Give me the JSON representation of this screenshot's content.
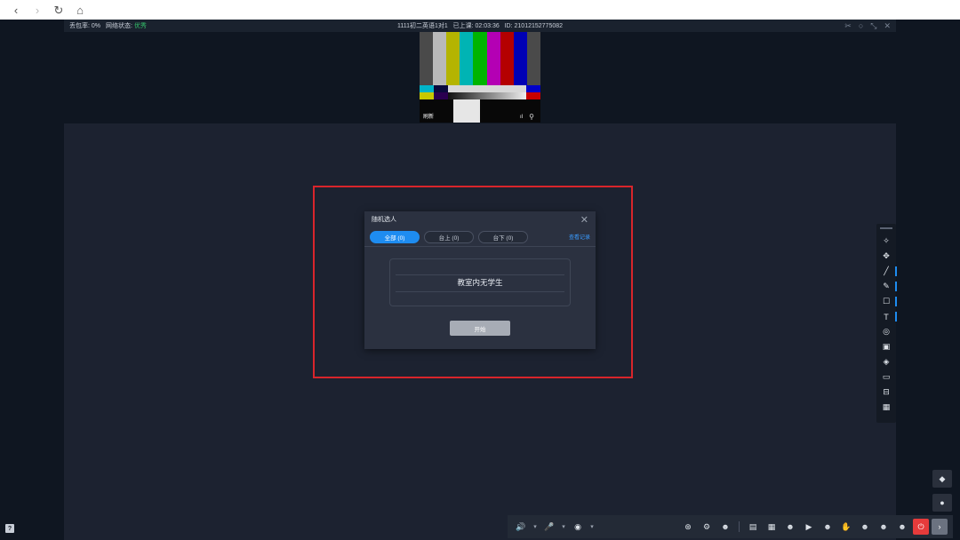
{
  "browser": {
    "back_icon": "‹",
    "forward_icon": "›",
    "refresh_icon": "↻",
    "home_icon": "⌂"
  },
  "status": {
    "loss_label": "丢包率:",
    "loss_value": "0%",
    "network_label": "网络状态:",
    "network_value": "优秀",
    "class_name": "1111初二英语1对1",
    "class_time_label": "已上课:",
    "class_time": "02:03:36",
    "id_label": "ID:",
    "id_value": "21012152775082",
    "icons": [
      "scissors-icon",
      "circle-icon",
      "shrink-icon",
      "close-icon"
    ]
  },
  "video": {
    "name": "刷新",
    "signal": "ıl",
    "mic": "🎙",
    "top_bars": [
      "#4a4a4a",
      "#b9b9b9",
      "#b4b400",
      "#00b4b4",
      "#00b400",
      "#b400b4",
      "#b40000",
      "#0000b4",
      "#4a4a4a"
    ],
    "colors": {
      "accent": "#1e8cf0",
      "highlight": "#d8252b"
    }
  },
  "dialog": {
    "title": "随机选人",
    "close": "✕",
    "tabs": [
      {
        "label": "全部 (0)",
        "active": true
      },
      {
        "label": "台上 (0)",
        "active": false
      },
      {
        "label": "台下 (0)",
        "active": false
      }
    ],
    "view_records": "查看记录",
    "empty_text": "教室内无学生",
    "start_label": "开始"
  },
  "toolbar": {
    "tools": [
      {
        "name": "laser-pointer-icon",
        "glyph": "✧"
      },
      {
        "name": "move-icon",
        "glyph": "✥"
      },
      {
        "name": "pen-icon",
        "glyph": "╱",
        "mark": true
      },
      {
        "name": "highlighter-icon",
        "glyph": "✎",
        "mark": true
      },
      {
        "name": "rectangle-icon",
        "glyph": "☐",
        "mark": true
      },
      {
        "name": "text-icon",
        "glyph": "T",
        "mark": true
      },
      {
        "name": "target-icon",
        "glyph": "◎"
      },
      {
        "name": "image-icon",
        "glyph": "▣"
      },
      {
        "name": "eraser-icon",
        "glyph": "◈"
      },
      {
        "name": "folder-icon",
        "glyph": "▭"
      },
      {
        "name": "toolbox-icon",
        "glyph": "⊟"
      },
      {
        "name": "table-icon",
        "glyph": "▦"
      }
    ]
  },
  "side_buttons": [
    {
      "name": "tag-icon",
      "glyph": "◆"
    },
    {
      "name": "chat-icon",
      "glyph": "●"
    }
  ],
  "bottom": {
    "speaker": "🔊",
    "mic": "🎤",
    "camera": "◉",
    "caret": "▾",
    "icons": [
      {
        "name": "screen-share-icon",
        "glyph": "⊛"
      },
      {
        "name": "settings-icon",
        "glyph": "⚙"
      },
      {
        "name": "single-user-icon",
        "glyph": "☻"
      },
      {
        "name": "courseware-icon",
        "glyph": "▤"
      },
      {
        "name": "layout-icon",
        "glyph": "▦"
      },
      {
        "name": "add-user-icon",
        "glyph": "☻"
      },
      {
        "name": "video-icon",
        "glyph": "▶"
      },
      {
        "name": "user-star-icon",
        "glyph": "☻"
      },
      {
        "name": "raise-hand-icon",
        "glyph": "✋"
      },
      {
        "name": "user-list-icon",
        "glyph": "☻"
      },
      {
        "name": "users-icon",
        "glyph": "☻"
      },
      {
        "name": "user-settings-icon",
        "glyph": "☻"
      }
    ],
    "power": "⏻",
    "next": "›"
  },
  "corner": "?"
}
